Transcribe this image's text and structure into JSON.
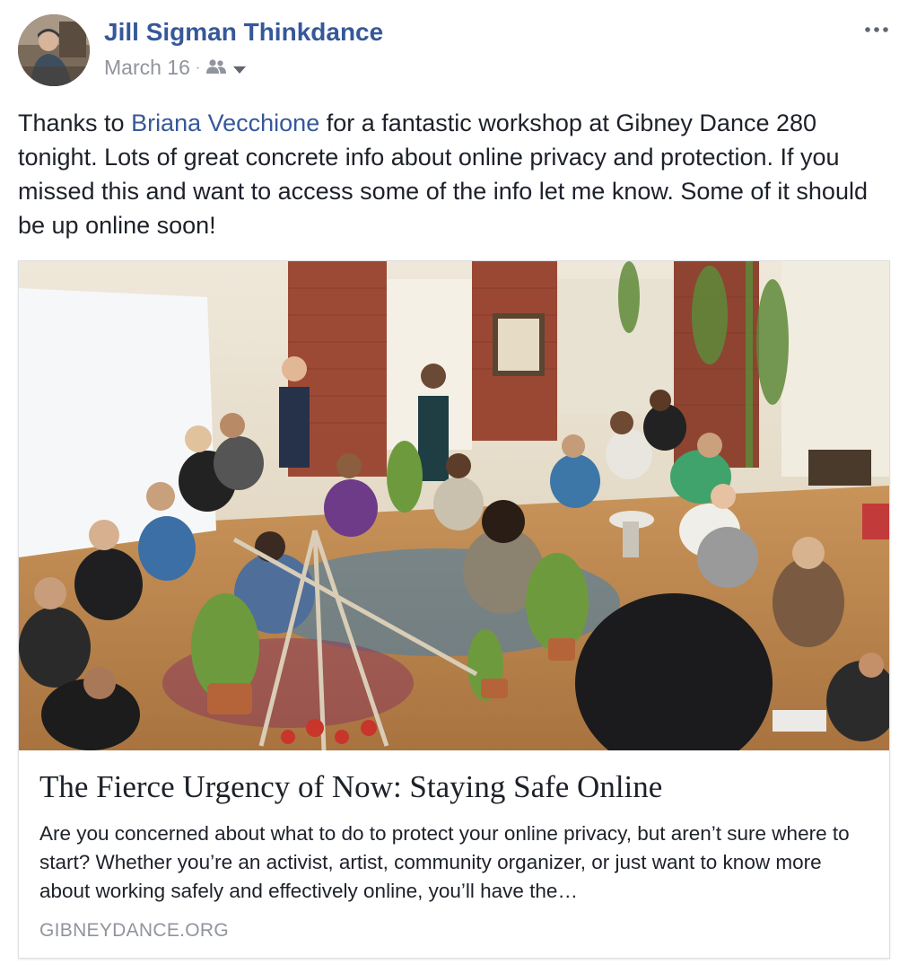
{
  "header": {
    "author": "Jill Sigman Thinkdance",
    "date": "March 16",
    "separator": "·",
    "audience_icon": "friends-icon",
    "dropdown_icon": "caret-down-icon",
    "more_icon": "more-horizontal-icon"
  },
  "post": {
    "text_before": "Thanks to ",
    "mention": "Briana Vecchione",
    "text_after": " for a fantastic workshop at Gibney Dance 280 tonight. Lots of great concrete info about online privacy and protection. If you missed this and want to access some of the info let me know. Some of it should be up online soon!"
  },
  "link_card": {
    "image_description_icon": "photo-workshop-circle",
    "title": "The Fierce Urgency of Now: Staying Safe Online",
    "description": "Are you concerned about what to do to protect your online privacy, but aren’t sure where to start? Whether you’re an activist, artist, community organizer, or just want to know more about working safely and effectively online, you’ll have the…",
    "domain": "GIBNEYDANCE.ORG"
  },
  "colors": {
    "link_blue": "#365899",
    "meta_gray": "#90949c",
    "text": "#1d2129",
    "border": "#dddfe2"
  }
}
